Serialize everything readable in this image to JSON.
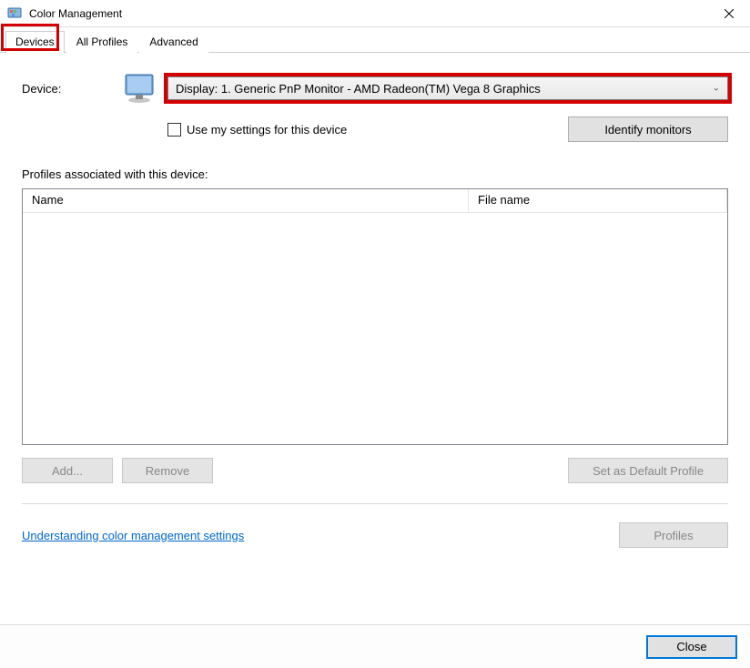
{
  "titlebar": {
    "title": "Color Management"
  },
  "tabs": {
    "devices": "Devices",
    "all_profiles": "All Profiles",
    "advanced": "Advanced"
  },
  "device": {
    "label": "Device:",
    "dropdown_value": "Display: 1. Generic PnP Monitor - AMD Radeon(TM) Vega 8 Graphics",
    "use_my_settings": "Use my settings for this device",
    "identify_monitors": "Identify monitors"
  },
  "profiles": {
    "label": "Profiles associated with this device:",
    "col_name": "Name",
    "col_file": "File name"
  },
  "buttons": {
    "add": "Add...",
    "remove": "Remove",
    "set_default": "Set as Default Profile",
    "profiles": "Profiles",
    "close": "Close"
  },
  "link": {
    "understanding": "Understanding color management settings"
  }
}
